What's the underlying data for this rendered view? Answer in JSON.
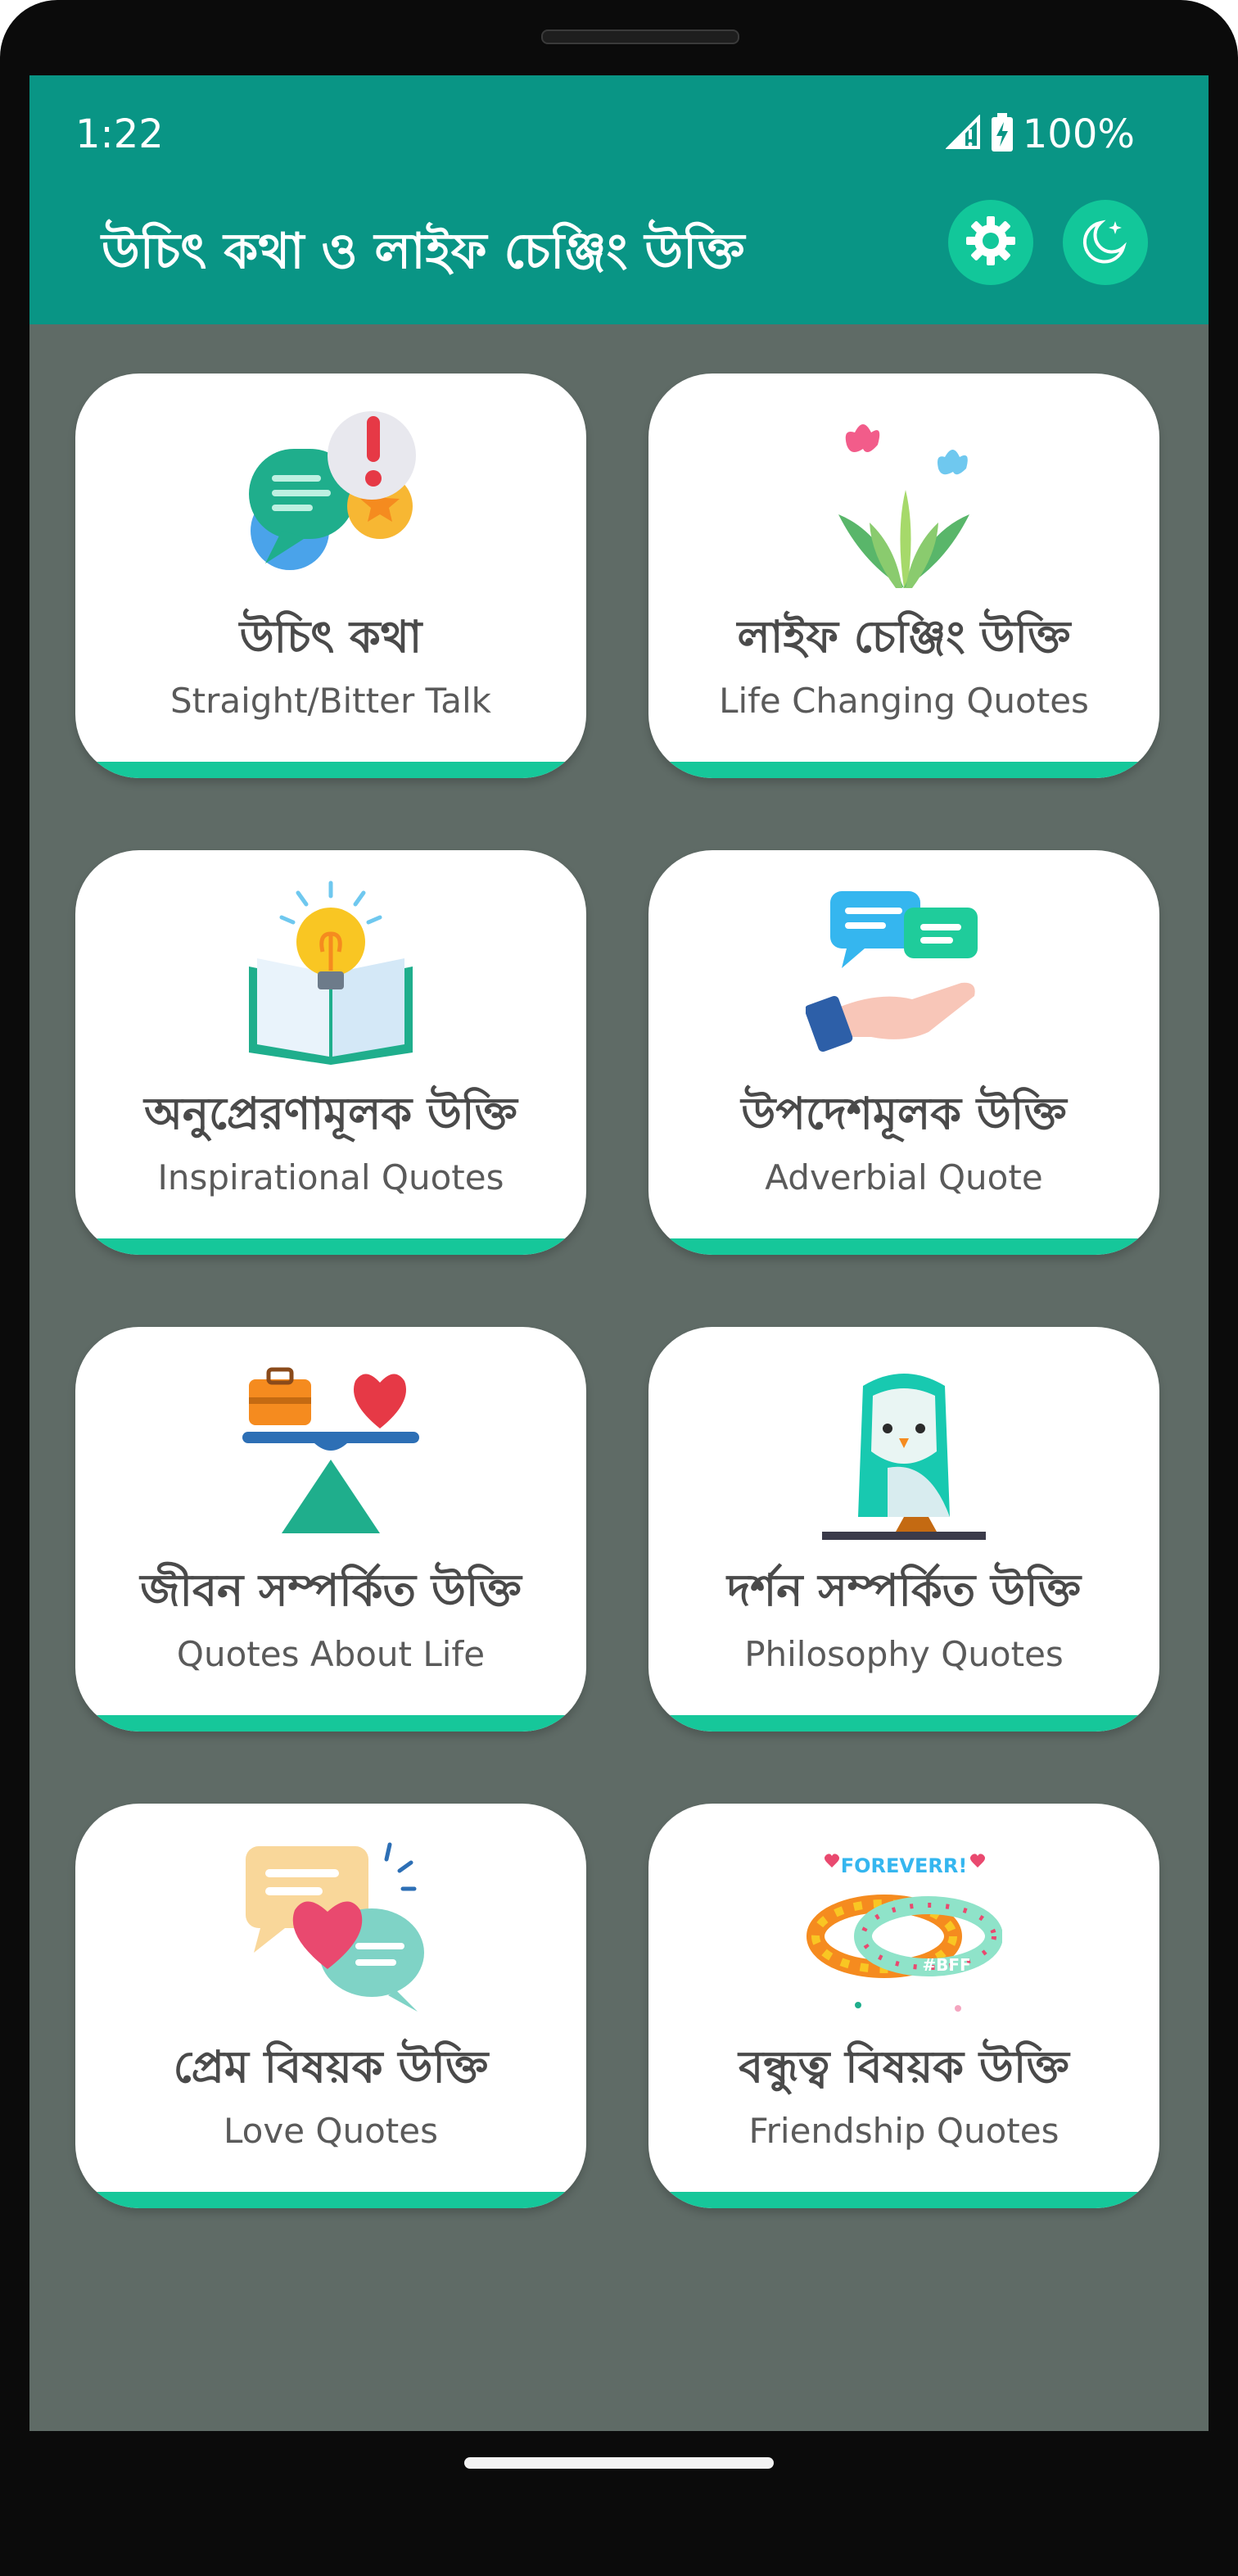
{
  "status_bar": {
    "time": "1:22",
    "battery": "100%",
    "icons": [
      "signal-icon",
      "battery-charging-icon"
    ]
  },
  "app_bar": {
    "title": "উচিৎ কথা ও লাইফ চেঞ্জিং উক্তি",
    "background": "#099585",
    "button_color": "#12c79a",
    "actions": [
      "settings-gear-icon",
      "night-mode-moon-icon"
    ]
  },
  "screen_background": "#5f6b66",
  "card_accent": "#16c79a",
  "cards": [
    {
      "bn": "উচিৎ কথা",
      "en": "Straight/Bitter Talk",
      "icon": "chat-bubbles-icon"
    },
    {
      "bn": "লাইফ চেঞ্জিং উক্তি",
      "en": "Life Changing Quotes",
      "icon": "plant-butterflies-icon"
    },
    {
      "bn": "অনুপ্রেরণামূলক উক্তি",
      "en": "Inspirational Quotes",
      "icon": "book-lightbulb-icon"
    },
    {
      "bn": "উপদেশমূলক উক্তি",
      "en": "Adverbial Quote",
      "icon": "hand-chat-icon"
    },
    {
      "bn": "জীবন সম্পর্কিত উক্তি",
      "en": "Quotes About Life",
      "icon": "balance-scale-icon"
    },
    {
      "bn": "দর্শন সম্পর্কিত উক্তি",
      "en": "Philosophy Quotes",
      "icon": "owl-icon"
    },
    {
      "bn": "প্রেম বিষয়ক উক্তি",
      "en": "Love Quotes",
      "icon": "heart-chat-icon"
    },
    {
      "bn": "বন্ধুত্ব বিষয়ক উক্তি",
      "en": "Friendship Quotes",
      "icon": "friendship-bands-icon",
      "band_text": [
        "FOREVERR!",
        "#BFF"
      ]
    }
  ]
}
